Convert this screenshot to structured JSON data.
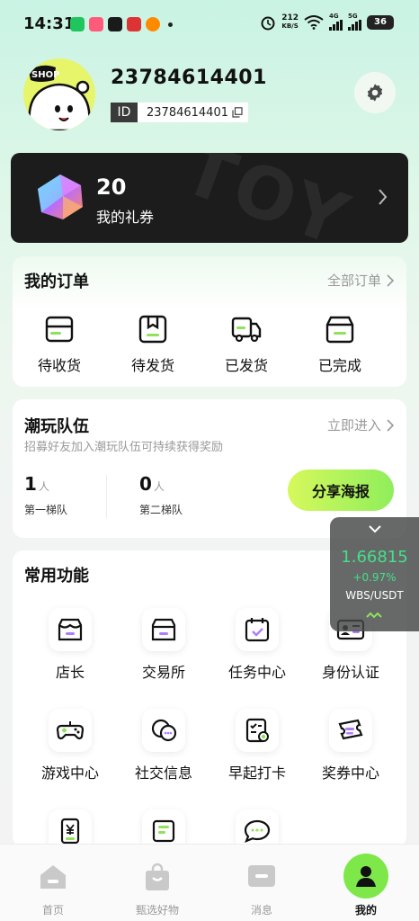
{
  "status_bar": {
    "time": "14:31",
    "net_speed_value": "212",
    "net_speed_unit": "KB/S",
    "net_type_1": "4G",
    "net_type_2": "5G",
    "battery": "36"
  },
  "profile": {
    "avatar_badge": "SHOP",
    "username": "23784614401",
    "id_label": "ID",
    "id_value": "23784614401"
  },
  "coupon": {
    "count": "20",
    "label": "我的礼券",
    "watermark": "TOY"
  },
  "orders": {
    "title": "我的订单",
    "all_link": "全部订单",
    "items": [
      {
        "label": "待收货",
        "icon": "inbox-icon"
      },
      {
        "label": "待发货",
        "icon": "package-icon"
      },
      {
        "label": "已发货",
        "icon": "truck-icon"
      },
      {
        "label": "已完成",
        "icon": "box-done-icon"
      }
    ]
  },
  "team": {
    "title": "潮玩队伍",
    "join_link": "立即进入",
    "subtitle": "招募好友加入潮玩队伍可持续获得奖励",
    "tier1_count": "1",
    "tier1_unit": "人",
    "tier1_label": "第一梯队",
    "tier2_count": "0",
    "tier2_unit": "人",
    "tier2_label": "第二梯队",
    "share_button": "分享海报"
  },
  "functions": {
    "title": "常用功能",
    "items": [
      {
        "label": "店长",
        "icon": "store-icon"
      },
      {
        "label": "交易所",
        "icon": "exchange-store-icon"
      },
      {
        "label": "任务中心",
        "icon": "calendar-check-icon"
      },
      {
        "label": "身份认证",
        "icon": "id-card-icon"
      },
      {
        "label": "游戏中心",
        "icon": "gamepad-icon"
      },
      {
        "label": "社交信息",
        "icon": "chat-bubbles-icon"
      },
      {
        "label": "早起打卡",
        "icon": "checklist-icon"
      },
      {
        "label": "奖券中心",
        "icon": "ticket-icon"
      },
      {
        "label": "",
        "icon": "yuan-phone-icon"
      },
      {
        "label": "",
        "icon": "wallet-icon"
      },
      {
        "label": "",
        "icon": "message-icon"
      }
    ]
  },
  "ticker": {
    "price": "1.66815",
    "change": "+0.97%",
    "pair": "WBS/USDT"
  },
  "bottom_nav": {
    "items": [
      {
        "label": "首页",
        "icon": "home-icon"
      },
      {
        "label": "甄选好物",
        "icon": "shopping-bag-icon"
      },
      {
        "label": "消息",
        "icon": "message-icon"
      },
      {
        "label": "我的",
        "icon": "profile-icon"
      }
    ],
    "active_index": 3
  },
  "colors": {
    "accent_green": "#7ee84a",
    "price_up": "#43e08a",
    "card_dark": "#1c1c1c"
  }
}
